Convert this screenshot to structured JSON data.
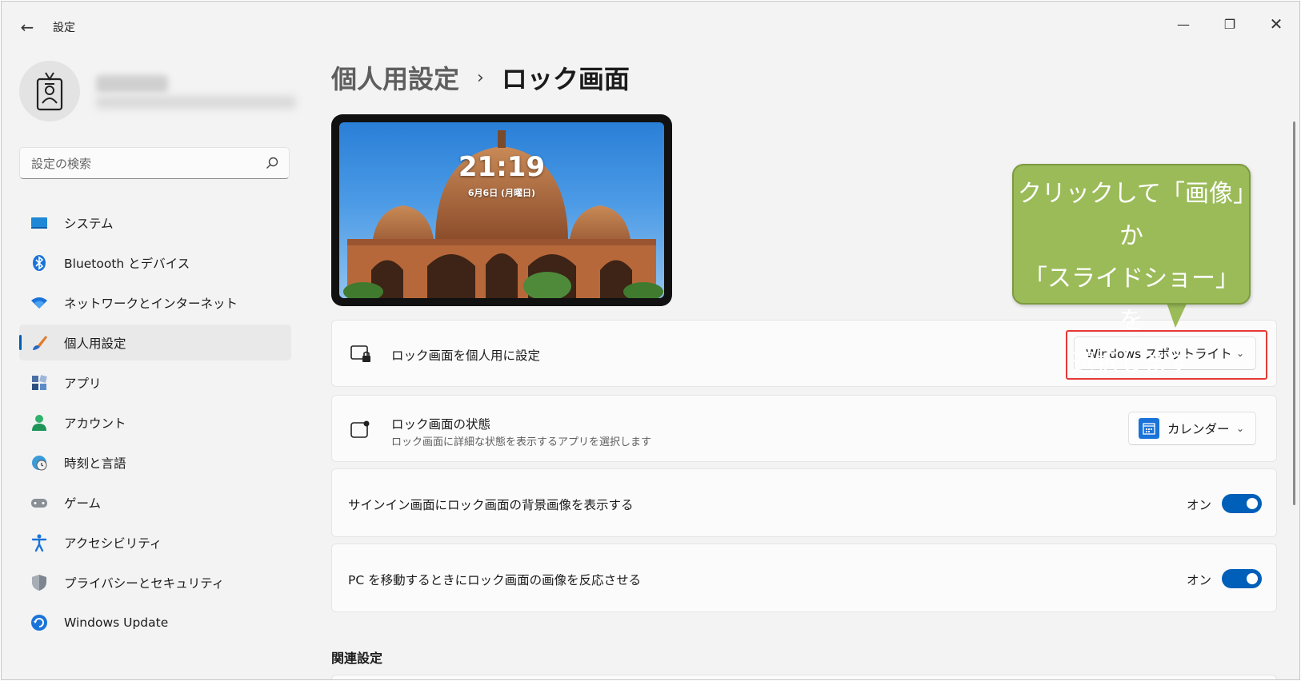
{
  "window": {
    "title": "設定",
    "back_icon": "back-arrow-icon",
    "controls": {
      "minimize": "—",
      "maximize": "❐",
      "close": "✕"
    }
  },
  "profile": {
    "avatar_icon": "badge-avatar-icon",
    "name_blurred": true
  },
  "search": {
    "placeholder": "設定の検索",
    "icon": "search-icon"
  },
  "sidebar": {
    "items": [
      {
        "label": "システム",
        "icon": "system-display-icon",
        "active": false
      },
      {
        "label": "Bluetooth とデバイス",
        "icon": "bluetooth-icon",
        "active": false
      },
      {
        "label": "ネットワークとインターネット",
        "icon": "wifi-icon",
        "active": false
      },
      {
        "label": "個人用設定",
        "icon": "brush-icon",
        "active": true
      },
      {
        "label": "アプリ",
        "icon": "apps-icon",
        "active": false
      },
      {
        "label": "アカウント",
        "icon": "account-icon",
        "active": false
      },
      {
        "label": "時刻と言語",
        "icon": "globe-clock-icon",
        "active": false
      },
      {
        "label": "ゲーム",
        "icon": "gamepad-icon",
        "active": false
      },
      {
        "label": "アクセシビリティ",
        "icon": "accessibility-icon",
        "active": false
      },
      {
        "label": "プライバシーとセキュリティ",
        "icon": "shield-icon",
        "active": false
      },
      {
        "label": "Windows Update",
        "icon": "windows-update-icon",
        "active": false
      }
    ]
  },
  "breadcrumb": {
    "parent": "個人用設定",
    "separator": "›",
    "current": "ロック画面"
  },
  "preview": {
    "time": "21:19",
    "date": "6月6日 (月曜日)"
  },
  "settings": {
    "personalize": {
      "title": "ロック画面を個人用に設定",
      "icon": "lock-screen-icon",
      "dropdown_value": "Windows スポットライト"
    },
    "status": {
      "title": "ロック画面の状態",
      "subtitle": "ロック画面に詳細な状態を表示するアプリを選択します",
      "icon": "lock-status-icon",
      "dropdown_value": "カレンダー",
      "dropdown_icon": "calendar-icon"
    },
    "signin_background": {
      "title": "サインイン画面にロック画面の背景画像を表示する",
      "state_label": "オン",
      "on": true
    },
    "motion": {
      "title": "PC を移動するときにロック画面の画像を反応させる",
      "state_label": "オン",
      "on": true
    }
  },
  "related": {
    "title": "関連設定"
  },
  "annotation": {
    "line1": "クリックして「画像」か",
    "line2": "「スライドショー」を",
    "line3": "選択します",
    "fill_color": "#9bbb59",
    "highlight_color": "#e53935"
  },
  "colors": {
    "accent": "#005fb8",
    "background": "#f3f3f3"
  }
}
